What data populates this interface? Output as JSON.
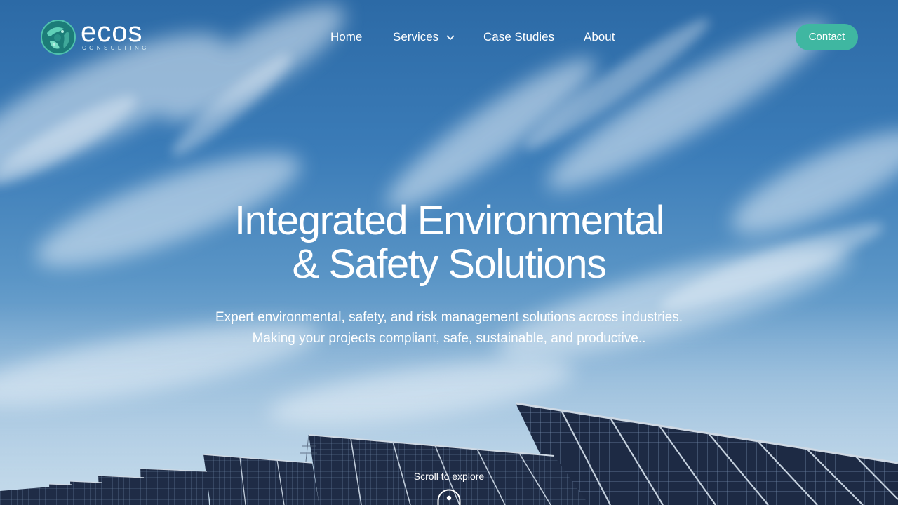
{
  "brand": {
    "name": "ecos",
    "tagline": "CONSULTING",
    "accent_color": "#3fb7a1",
    "logo_icon": "globe-leaf-mark-icon"
  },
  "nav": {
    "items": [
      {
        "label": "Home"
      },
      {
        "label": "Services",
        "icon": "chevron-down-icon"
      },
      {
        "label": "Case Studies"
      },
      {
        "label": "About"
      }
    ],
    "cta_label": "Contact"
  },
  "hero": {
    "headline_line1": "Integrated Environmental",
    "headline_line2": "& Safety Solutions",
    "sub_line1": "Expert environmental, safety, and risk management solutions across industries.",
    "sub_line2": "Making your projects compliant, safe, sustainable, and productive..",
    "scroll_label": "Scroll to explore",
    "scroll_icon": "mouse-scroll-icon"
  }
}
